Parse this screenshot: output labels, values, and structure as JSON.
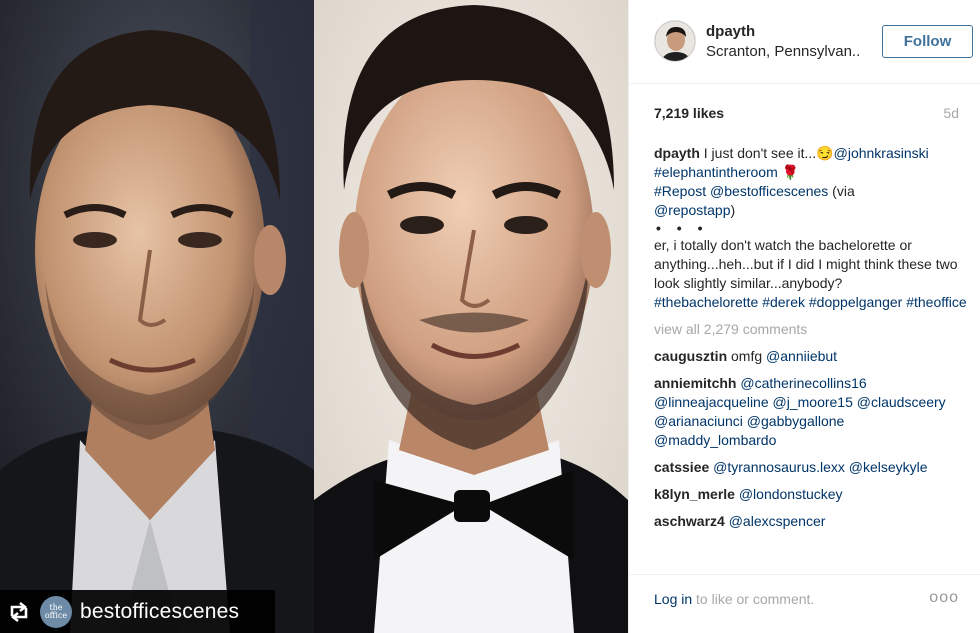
{
  "post": {
    "repost_username": "bestofficescenes",
    "repost_avatar_text": "the office",
    "author": "dpayth",
    "location": "Scranton, Pennsylvan..",
    "follow_label": "Follow",
    "likes": "7,219 likes",
    "age": "5d"
  },
  "caption": {
    "user": "dpayth",
    "line1_text": " I just don't see it...",
    "emoji1": "😏",
    "mention": "@johnkrasinski",
    "tag_elephant": "#elephantintheroom",
    "emoji2": "🌹",
    "tag_repost": "#Repost @bestofficescenes",
    "via_text": " (via",
    "repostapp": "@repostapp",
    "close_paren": ")",
    "dots": "• • •",
    "body": "er, i totally don't watch the bachelorette or anything...heh...but if I did I might think these two look slightly similar...anybody?",
    "tags": "#thebachelorette #derek #doppelganger #theoffice"
  },
  "view_all": "view all 2,279 comments",
  "comments": [
    {
      "user": "caugusztin",
      "text": " omfg ",
      "mentions": "@anniiebut"
    },
    {
      "user": "anniemitchh",
      "text": " ",
      "mentions": "@catherinecollins16 @linneajacqueline @j_moore15 @claudsceery @arianaciunci @gabbygallone @maddy_lombardo"
    },
    {
      "user": "catssiee",
      "text": " ",
      "mentions": "@tyrannosaurus.lexx @kelseykyle"
    },
    {
      "user": "k8lyn_merle",
      "text": " ",
      "mentions": "@londonstuckey"
    },
    {
      "user": "aschwarz4",
      "text": " ",
      "mentions": "@alexcspencer"
    }
  ],
  "footer": {
    "login_link": "Log in",
    "login_rest": " to like or comment.",
    "more": "ooo"
  },
  "icons": {
    "repost": "repost-arrows-icon",
    "more": "more-options-icon"
  },
  "colors": {
    "link": "#003569",
    "follow": "#3f729b",
    "muted": "#a5a7aa"
  }
}
